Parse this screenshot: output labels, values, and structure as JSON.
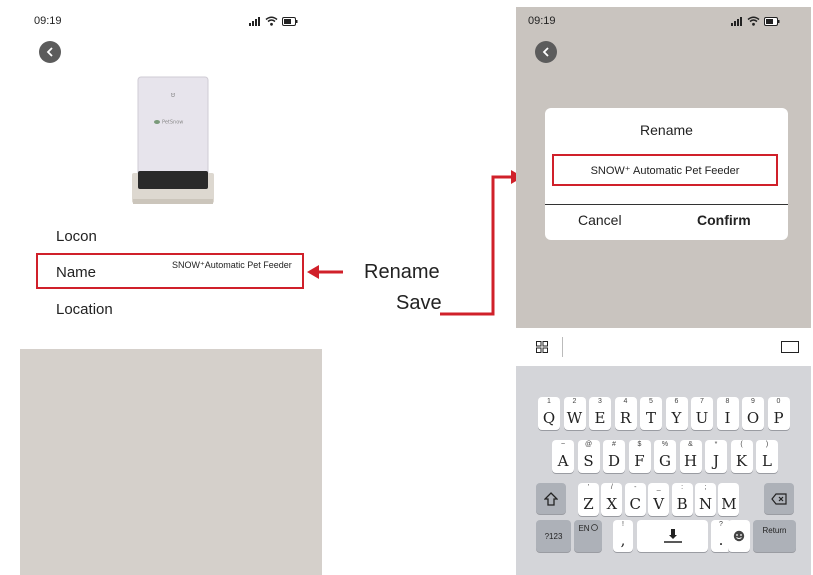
{
  "left_screen": {
    "status": {
      "time": "09:19"
    },
    "device_image_brand": "PetSnow",
    "rows": [
      {
        "label": "Locon"
      },
      {
        "label": "Name",
        "value": "SNOW⁺Automatic Pet Feeder"
      },
      {
        "label": "Location"
      }
    ]
  },
  "annotations": {
    "rename": "Rename",
    "save": "Save"
  },
  "right_screen": {
    "status": {
      "time": "09:19"
    },
    "dialog": {
      "title": "Rename",
      "input_value": "SNOW⁺ Automatic  Pet  Feeder",
      "cancel": "Cancel",
      "confirm": "Confirm"
    },
    "keyboard": {
      "row1": [
        {
          "k": "Q",
          "s": "1"
        },
        {
          "k": "W",
          "s": "2"
        },
        {
          "k": "E",
          "s": "3"
        },
        {
          "k": "R",
          "s": "4"
        },
        {
          "k": "T",
          "s": "5"
        },
        {
          "k": "Y",
          "s": "6"
        },
        {
          "k": "U",
          "s": "7"
        },
        {
          "k": "I",
          "s": "8"
        },
        {
          "k": "O",
          "s": "9"
        },
        {
          "k": "P",
          "s": "0"
        }
      ],
      "row2": [
        {
          "k": "A",
          "s": "~"
        },
        {
          "k": "S",
          "s": "@"
        },
        {
          "k": "D",
          "s": "#"
        },
        {
          "k": "F",
          "s": "$"
        },
        {
          "k": "G",
          "s": "%"
        },
        {
          "k": "H",
          "s": "&"
        },
        {
          "k": "J",
          "s": "*"
        },
        {
          "k": "K",
          "s": "("
        },
        {
          "k": "L",
          "s": ")"
        }
      ],
      "row3": [
        {
          "k": "Z",
          "s": "'"
        },
        {
          "k": "X",
          "s": "/"
        },
        {
          "k": "C",
          "s": "-"
        },
        {
          "k": "V",
          "s": "_"
        },
        {
          "k": "B",
          "s": ":"
        },
        {
          "k": "N",
          "s": ";"
        },
        {
          "k": "M",
          "s": ""
        }
      ],
      "bottom": {
        "num": "?123",
        "lang": "EN",
        "comma_top": "!",
        "comma": ",",
        "period_top": "?",
        "period": ".",
        "return": "Return"
      }
    }
  },
  "colors": {
    "highlight": "#d0202a"
  }
}
